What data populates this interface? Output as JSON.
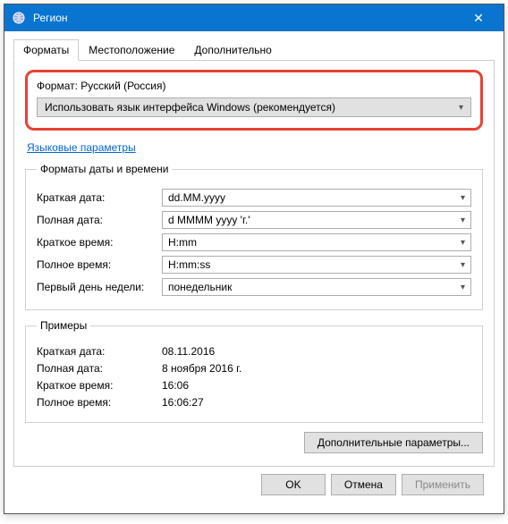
{
  "window": {
    "title": "Регион"
  },
  "tabs": {
    "formats": "Форматы",
    "location": "Местоположение",
    "advanced": "Дополнительно"
  },
  "format_section": {
    "label": "Формат: Русский (Россия)",
    "dropdown_value": "Использовать язык интерфейса Windows (рекомендуется)"
  },
  "language_link": "Языковые параметры",
  "datetime_formats": {
    "legend": "Форматы даты и времени",
    "short_date_label": "Краткая дата:",
    "short_date_value": "dd.MM.yyyy",
    "long_date_label": "Полная дата:",
    "long_date_value": "d MMMM yyyy 'г.'",
    "short_time_label": "Краткое время:",
    "short_time_value": "H:mm",
    "long_time_label": "Полное время:",
    "long_time_value": "H:mm:ss",
    "first_day_label": "Первый день недели:",
    "first_day_value": "понедельник"
  },
  "examples": {
    "legend": "Примеры",
    "short_date_label": "Краткая дата:",
    "short_date_value": "08.11.2016",
    "long_date_label": "Полная дата:",
    "long_date_value": "8 ноября 2016 г.",
    "short_time_label": "Краткое время:",
    "short_time_value": "16:06",
    "long_time_label": "Полное время:",
    "long_time_value": "16:06:27"
  },
  "buttons": {
    "additional": "Дополнительные параметры...",
    "ok": "OK",
    "cancel": "Отмена",
    "apply": "Применить"
  }
}
